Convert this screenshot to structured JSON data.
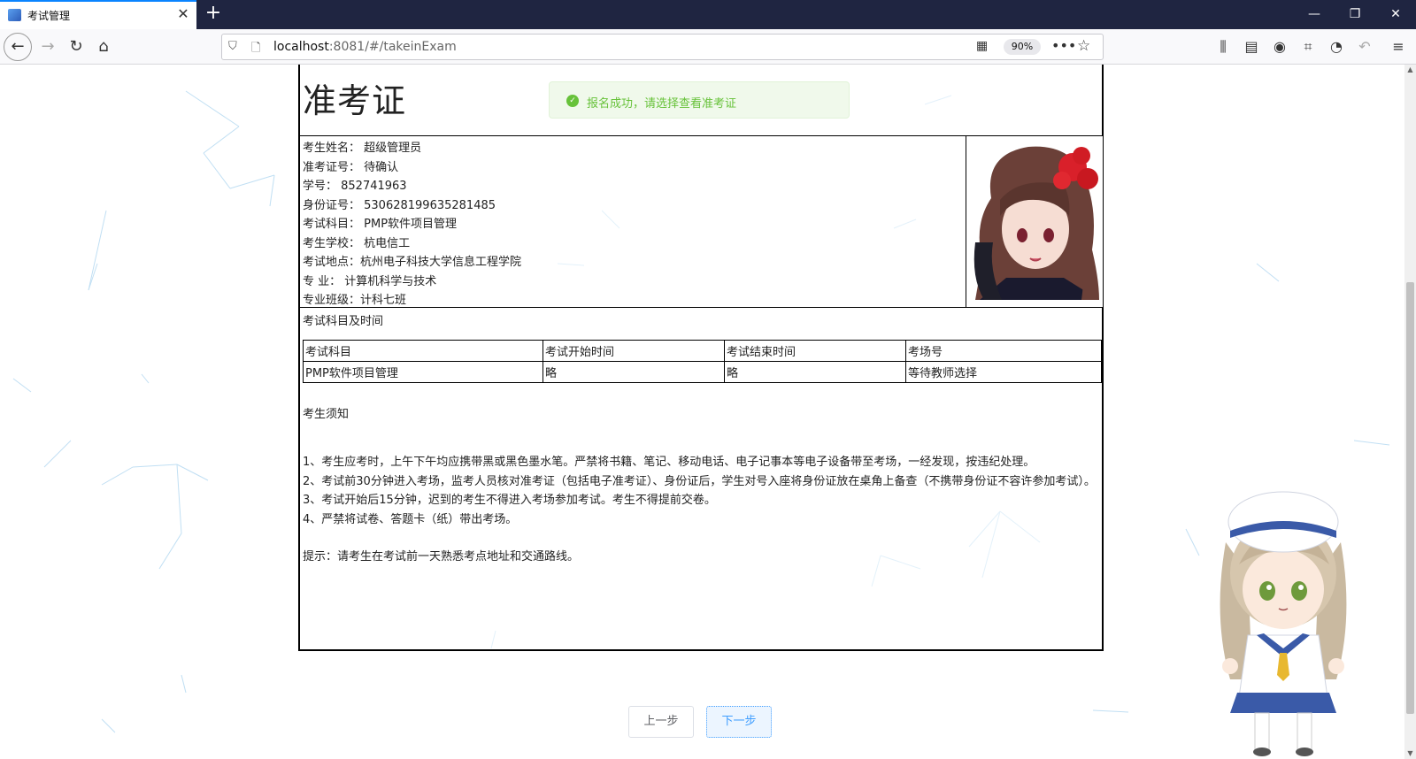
{
  "browser": {
    "tab_title": "考试管理",
    "tab_close": "✕",
    "new_tab": "+",
    "url_host": "localhost",
    "url_rest": ":8081/#/takeinExam",
    "zoom": "90%",
    "window_controls": {
      "minimize": "—",
      "restore": "❐",
      "close": "✕"
    }
  },
  "toast": {
    "message": "报名成功，请选择查看准考证",
    "status": "success",
    "color": "#67c23a"
  },
  "ticket": {
    "title": "准考证",
    "info": [
      "考生姓名：  超级管理员",
      "准考证号：  待确认",
      "学号：  852741963",
      "身份证号：  530628199635281485",
      "考试科目：  PMP软件项目管理",
      "考生学校：  杭电信工",
      "考试地点：杭州电子科技大学信息工程学院",
      "专  业：  计算机科学与技术",
      "专业班级：计科七班"
    ],
    "section_label": "考试科目及时间",
    "table": {
      "headers": [
        "考试科目",
        "考试开始时间",
        "考试结束时间",
        "考场号"
      ],
      "rows": [
        [
          "PMP软件项目管理",
          "略",
          "略",
          "等待教师选择"
        ]
      ]
    },
    "notice_title": "考生须知",
    "notice_items": [
      "1、考生应考时，上午下午均应携带黑或黑色墨水笔。严禁将书籍、笔记、移动电话、电子记事本等电子设备带至考场，一经发现，按违纪处理。",
      "2、考试前30分钟进入考场，监考人员核对准考证（包括电子准考证）、身份证后，学生对号入座将身份证放在桌角上备查（不携带身份证不容许参加考试）。",
      "3、考试开始后15分钟，迟到的考生不得进入考场参加考试。考生不得提前交卷。",
      "4、严禁将试卷、答题卡（纸）带出考场。"
    ],
    "tip": "提示：请考生在考试前一天熟悉考点地址和交通路线。"
  },
  "buttons": {
    "prev": "上一步",
    "next": "下一步"
  }
}
